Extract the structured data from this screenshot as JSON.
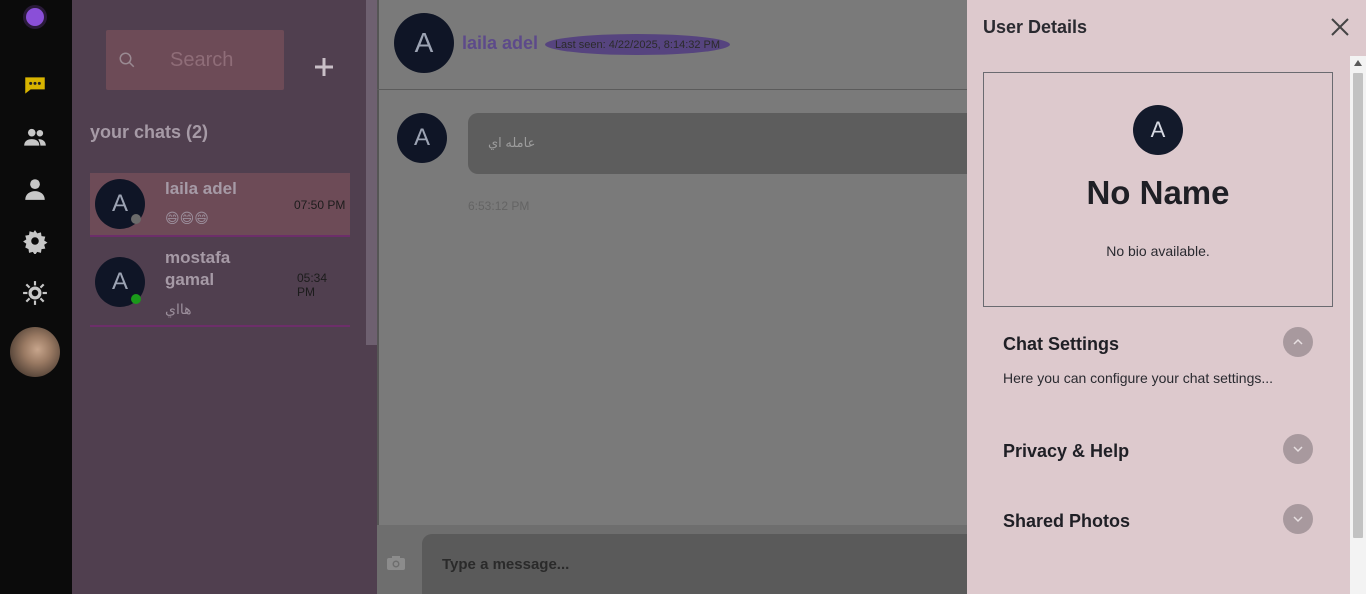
{
  "rail": {
    "nav": [
      {
        "name": "chats-icon",
        "color": "#d8b400"
      },
      {
        "name": "users-icon",
        "color": "#c7c7c7"
      },
      {
        "name": "profile-icon",
        "color": "#c7c7c7"
      },
      {
        "name": "settings-icon",
        "color": "#c7c7c7"
      },
      {
        "name": "theme-icon",
        "color": "#c7c7c7"
      }
    ]
  },
  "sidebar": {
    "search_placeholder": "Search",
    "chats_title": "your chats (2)",
    "chats": [
      {
        "initial": "A",
        "name": "laila adel",
        "message": "😄😄😄",
        "time": "07:50 PM",
        "status": "offline",
        "active": true
      },
      {
        "initial": "A",
        "name": "mostafa gamal",
        "message": "هااي",
        "time": "05:34 PM",
        "status": "online",
        "active": false
      }
    ]
  },
  "chat": {
    "contact_initial": "A",
    "contact_name": "laila adel",
    "last_seen": "Last seen: 4/22/2025, 8:14:32 PM",
    "messages": [
      {
        "initial": "A",
        "text": "عامله اي",
        "time": "6:53:12 PM"
      }
    ],
    "composer_placeholder": "Type a message..."
  },
  "details": {
    "title": "User Details",
    "profile_initial": "A",
    "profile_name": "No Name",
    "profile_bio": "No bio available.",
    "sections": [
      {
        "title": "Chat Settings",
        "description": "Here you can configure your chat settings...",
        "expanded": true
      },
      {
        "title": "Privacy & Help",
        "description": "",
        "expanded": false
      },
      {
        "title": "Shared Photos",
        "description": "",
        "expanded": false
      }
    ]
  },
  "colors": {
    "accent": "#5d4a8a",
    "online": "#1a9a1a",
    "offline": "#6b6b6b",
    "panel_bg": "#ddc9cd"
  }
}
